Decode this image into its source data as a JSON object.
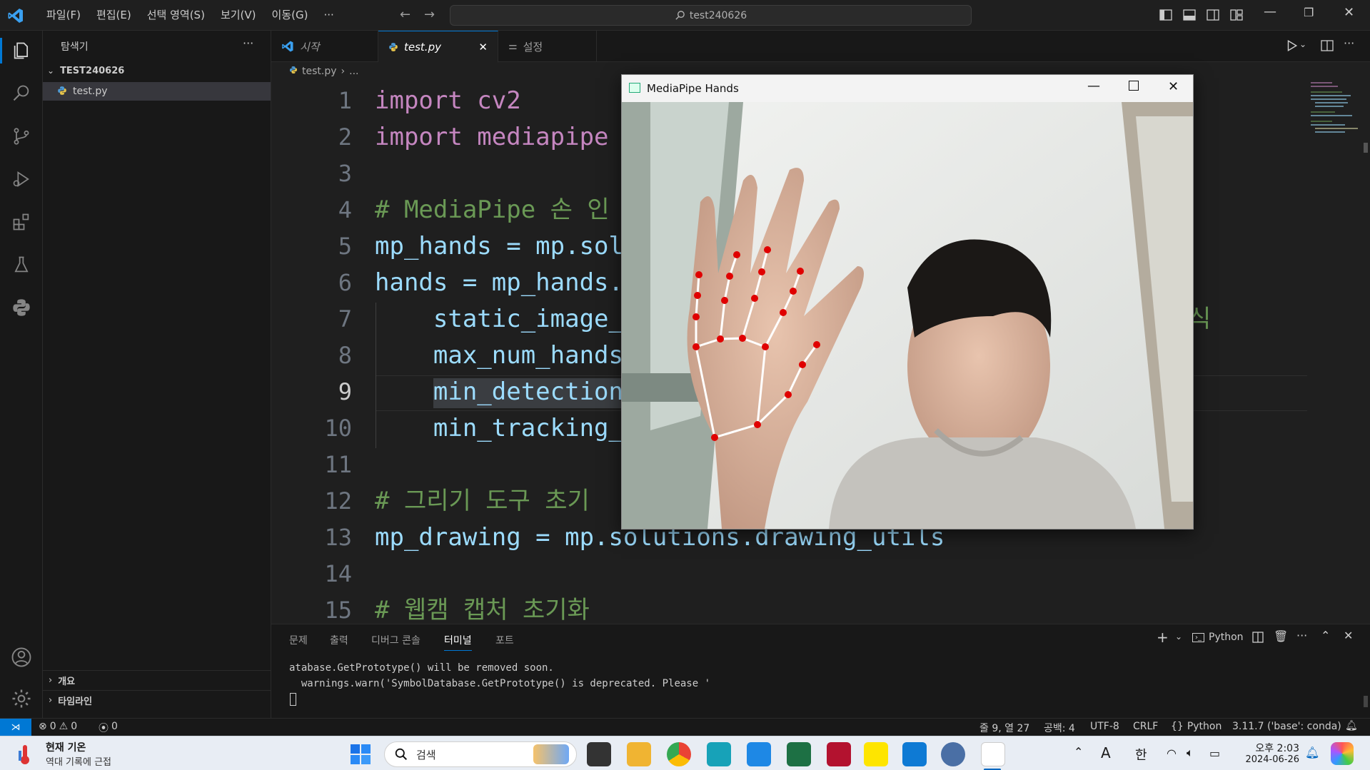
{
  "window": {
    "menu": [
      "파일(F)",
      "편집(E)",
      "선택 영역(S)",
      "보기(V)",
      "이동(G)",
      "···"
    ],
    "search_title": "test240626"
  },
  "sidebar": {
    "title": "탐색기",
    "more": "···",
    "folder": "TEST240626",
    "file": "test.py",
    "outline": "개요",
    "timeline": "타임라인"
  },
  "tabs": [
    {
      "label": "시작"
    },
    {
      "label": "test.py",
      "close": "✕"
    },
    {
      "label": "설정"
    }
  ],
  "breadcrumb": {
    "file": "test.py",
    "rest": "..."
  },
  "code": [
    {
      "n": "1",
      "text": "import cv2"
    },
    {
      "n": "2",
      "text": "import mediapipe"
    },
    {
      "n": "3",
      "text": ""
    },
    {
      "n": "4",
      "text": "# MediaPipe 손 인"
    },
    {
      "n": "5",
      "text": "mp_hands = mp.sol"
    },
    {
      "n": "6",
      "text": "hands = mp_hands."
    },
    {
      "n": "7",
      "text": "    static_image_"
    },
    {
      "n": "8",
      "text": "    max_num_hands"
    },
    {
      "n": "9",
      "text": "    min_detection"
    },
    {
      "n": "10",
      "text": "    min_tracking_"
    },
    {
      "n": "11",
      "text": ""
    },
    {
      "n": "12",
      "text": "# 그리기 도구 초기"
    },
    {
      "n": "13",
      "text": "mp_drawing = mp.solutions.drawing_utils"
    },
    {
      "n": "14",
      "text": ""
    },
    {
      "n": "15",
      "text": "# 웹캠 캡처 초기화"
    }
  ],
  "code_fragment_right": "식",
  "mp_window": {
    "title": "MediaPipe Hands"
  },
  "panel": {
    "tabs": [
      "문제",
      "출력",
      "디버그 콘솔",
      "터미널",
      "포트"
    ],
    "active_tab": "터미널",
    "terminal_kind": "Python",
    "lines": [
      "atabase.GetPrototype() will be removed soon.",
      "  warnings.warn('SymbolDatabase.GetPrototype() is deprecated. Please '"
    ]
  },
  "status": {
    "errors": "0",
    "warnings": "0",
    "ports": "0",
    "position": "줄 9, 열 27",
    "spaces": "공백: 4",
    "encoding": "UTF-8",
    "eol": "CRLF",
    "language": "Python",
    "interpreter": "3.11.7 ('base': conda)"
  },
  "taskbar": {
    "weather_title": "현재 기온",
    "weather_sub": "역대 기록에 근접",
    "search": "검색",
    "ime_a": "A",
    "ime_han": "한",
    "time": "오후 2:03",
    "date": "2024-06-26"
  },
  "colors": {
    "accent": "#0078d4",
    "landmark": "#e00000",
    "connector": "#ffffff"
  }
}
